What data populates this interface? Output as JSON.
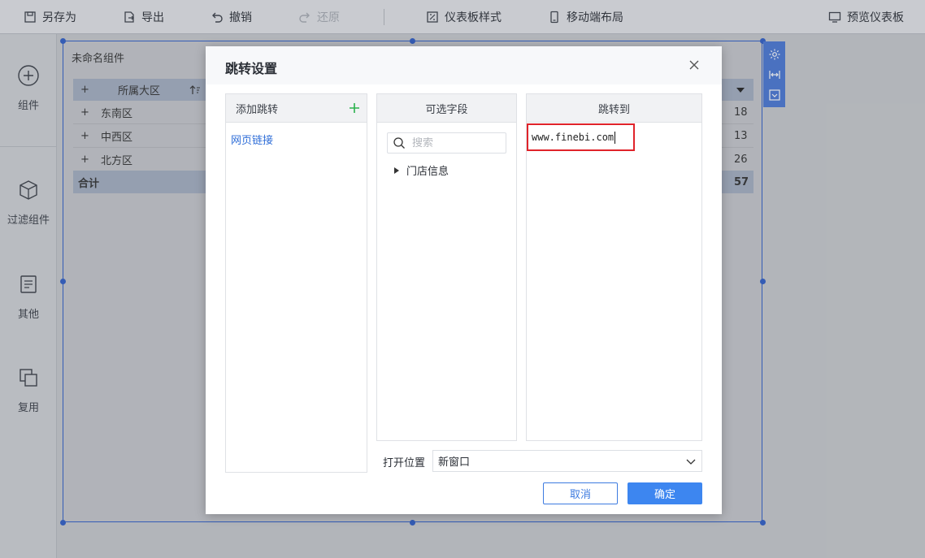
{
  "toolbar": {
    "save_as": "另存为",
    "export": "导出",
    "undo": "撤销",
    "redo": "还原",
    "dashboard_style": "仪表板样式",
    "mobile_layout": "移动端布局",
    "preview": "预览仪表板"
  },
  "sidebar": {
    "items": [
      {
        "label": "组件"
      },
      {
        "label": "过滤组件"
      },
      {
        "label": "其他"
      },
      {
        "label": "复用"
      }
    ]
  },
  "widget": {
    "title": "未命名组件",
    "table": {
      "header": {
        "expand": "+",
        "column": "所属大区"
      },
      "rows": [
        {
          "expand": "+",
          "region": "东南区",
          "value": "18"
        },
        {
          "expand": "+",
          "region": "中西区",
          "value": "13"
        },
        {
          "expand": "+",
          "region": "北方区",
          "value": "26"
        }
      ],
      "total": {
        "label": "合计",
        "value": "57"
      }
    }
  },
  "dialog": {
    "title": "跳转设置",
    "add_jump": {
      "header": "添加跳转",
      "item": "网页链接"
    },
    "fields": {
      "header": "可选字段",
      "search_placeholder": "搜索",
      "tree_item": "门店信息"
    },
    "jump_to": {
      "header": "跳转到",
      "url": "www.finebi.com"
    },
    "open_position": {
      "label": "打开位置",
      "value": "新窗口"
    },
    "cancel": "取消",
    "confirm": "确定"
  },
  "colors": {
    "accent": "#3d86f0",
    "highlight": "#e0232a",
    "add_green": "#2bb24c",
    "selection": "#2f5fc9"
  }
}
